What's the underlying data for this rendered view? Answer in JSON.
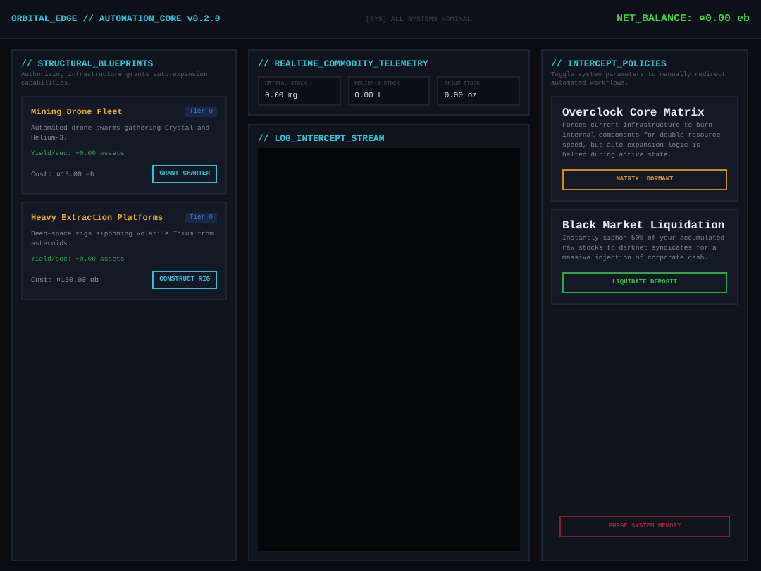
{
  "header": {
    "title": "ORBITAL_EDGE // AUTOMATION_CORE v0.2.0",
    "status": "[SYS] ALL SYSTEMS NOMINAL",
    "balance": "NET_BALANCE: ¤0.00 eb"
  },
  "blueprints": {
    "title": "// STRUCTURAL_BLUEPRINTS",
    "subtitle": "Authorizing infrastructure grants auto-expansion capabilities.",
    "items": [
      {
        "name": "Mining Drone Fleet",
        "tier": "Tier 0",
        "description": "Automated drone swarms gathering Crystal and Helium-3.",
        "yield": "Yield/sec: +0.00 assets",
        "cost": "Cost: ¤15.00 eb",
        "action": "GRANT CHARTER"
      },
      {
        "name": "Heavy Extraction Platforms",
        "tier": "Tier 0",
        "description": "Deep-space rigs siphoning volatile Thium from asteroids.",
        "yield": "Yield/sec: +0.00 assets",
        "cost": "Cost: ¤150.00 eb",
        "action": "CONSTRUCT RIG"
      }
    ]
  },
  "telemetry": {
    "title": "// REALTIME_COMMODITY_TELEMETRY",
    "stocks": [
      {
        "label": "CRYSTAL STOCK",
        "value": "0.00 mg"
      },
      {
        "label": "HELIUM-3 STOCK",
        "value": "0.00 L"
      },
      {
        "label": "THIUM STOCK",
        "value": "0.00 oz"
      }
    ]
  },
  "log": {
    "title": "// LOG_INTERCEPT_STREAM"
  },
  "policies": {
    "title": "// INTERCEPT_POLICIES",
    "subtitle": "Toggle system parameters to manually redirect automated workflows.",
    "items": [
      {
        "kind": "warning",
        "name": "Overclock Core Matrix",
        "description": "Forces current infrastructure to burn internal components for double resource speed, but auto-expansion logic is halted during active state.",
        "action": "MATRIX: DORMANT"
      },
      {
        "kind": "success",
        "name": "Black Market Liquidation",
        "description": "Instantly siphon 50% of your accumulated raw stocks to darknet syndicates for a massive injection of corporate cash.",
        "action": "LIQUIDATE DEPOSIT"
      }
    ],
    "danger_action": "PURGE SYSTEM MEMORY"
  }
}
